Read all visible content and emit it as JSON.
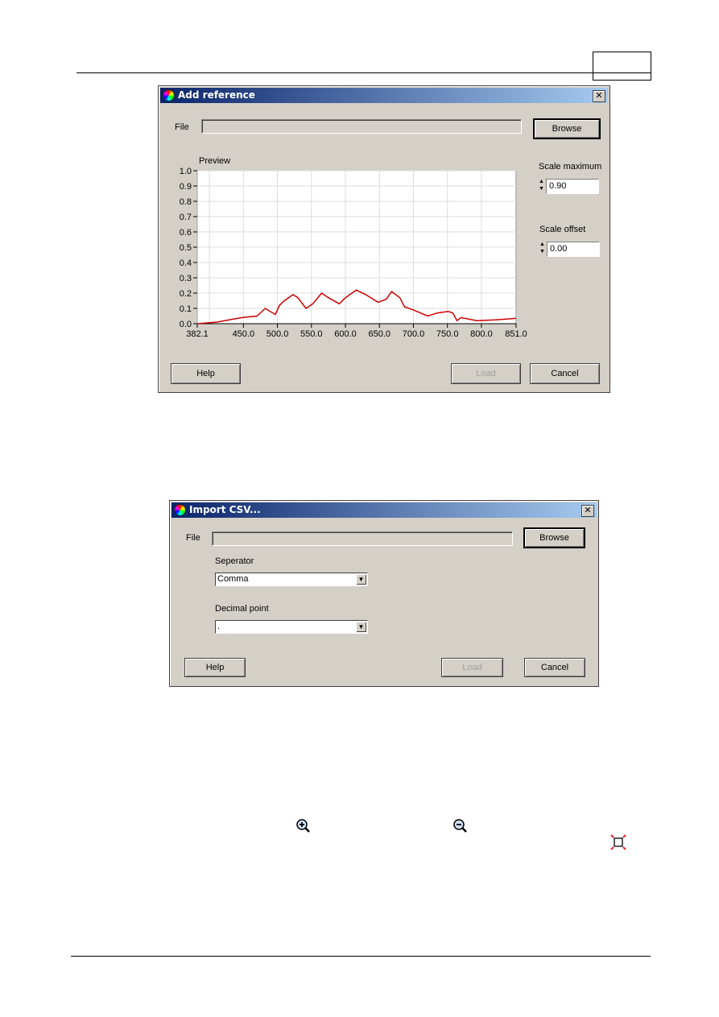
{
  "add_reference": {
    "title": "Add reference",
    "file_label": "File",
    "file_value": "",
    "browse": "Browse",
    "preview_label": "Preview",
    "scale_maximum_label": "Scale maximum",
    "scale_maximum": "0.90",
    "scale_offset_label": "Scale offset",
    "scale_offset": "0.00",
    "help": "Help",
    "load": "Load",
    "cancel": "Cancel"
  },
  "import_csv": {
    "title": "Import CSV...",
    "file_label": "File",
    "file_value": "",
    "browse": "Browse",
    "separator_label": "Seperator",
    "separator_value": "Comma",
    "decimal_label": "Decimal point",
    "decimal_value": ".",
    "help": "Help",
    "load": "Load",
    "cancel": "Cancel"
  },
  "icons": [
    "zoom-in-icon",
    "zoom-out-icon",
    "fit-to-window-icon"
  ],
  "chart_data": {
    "type": "line",
    "title": "Preview",
    "xlim": [
      382.1,
      851.0
    ],
    "ylim": [
      0.0,
      1.0
    ],
    "x_ticks": [
      "382.1",
      "450.0",
      "500.0",
      "550.0",
      "600.0",
      "650.0",
      "700.0",
      "750.0",
      "800.0",
      "851.0"
    ],
    "y_ticks": [
      "0.0",
      "0.1",
      "0.2",
      "0.3",
      "0.4",
      "0.5",
      "0.6",
      "0.7",
      "0.8",
      "0.9",
      "1.0"
    ],
    "grid": true,
    "line_color": "#cc0000",
    "x": [
      382.1,
      410,
      448,
      470,
      482,
      497,
      503,
      510,
      523,
      530,
      542,
      552,
      565,
      575,
      591,
      600,
      616,
      630,
      648,
      660,
      668,
      680,
      687,
      700,
      721,
      735,
      751,
      758,
      764,
      770,
      793,
      820,
      851
    ],
    "y": [
      0.0,
      0.01,
      0.04,
      0.05,
      0.1,
      0.06,
      0.12,
      0.15,
      0.19,
      0.17,
      0.1,
      0.13,
      0.2,
      0.17,
      0.13,
      0.17,
      0.22,
      0.19,
      0.14,
      0.16,
      0.21,
      0.17,
      0.11,
      0.09,
      0.05,
      0.07,
      0.08,
      0.07,
      0.02,
      0.04,
      0.02,
      0.025,
      0.035
    ]
  }
}
